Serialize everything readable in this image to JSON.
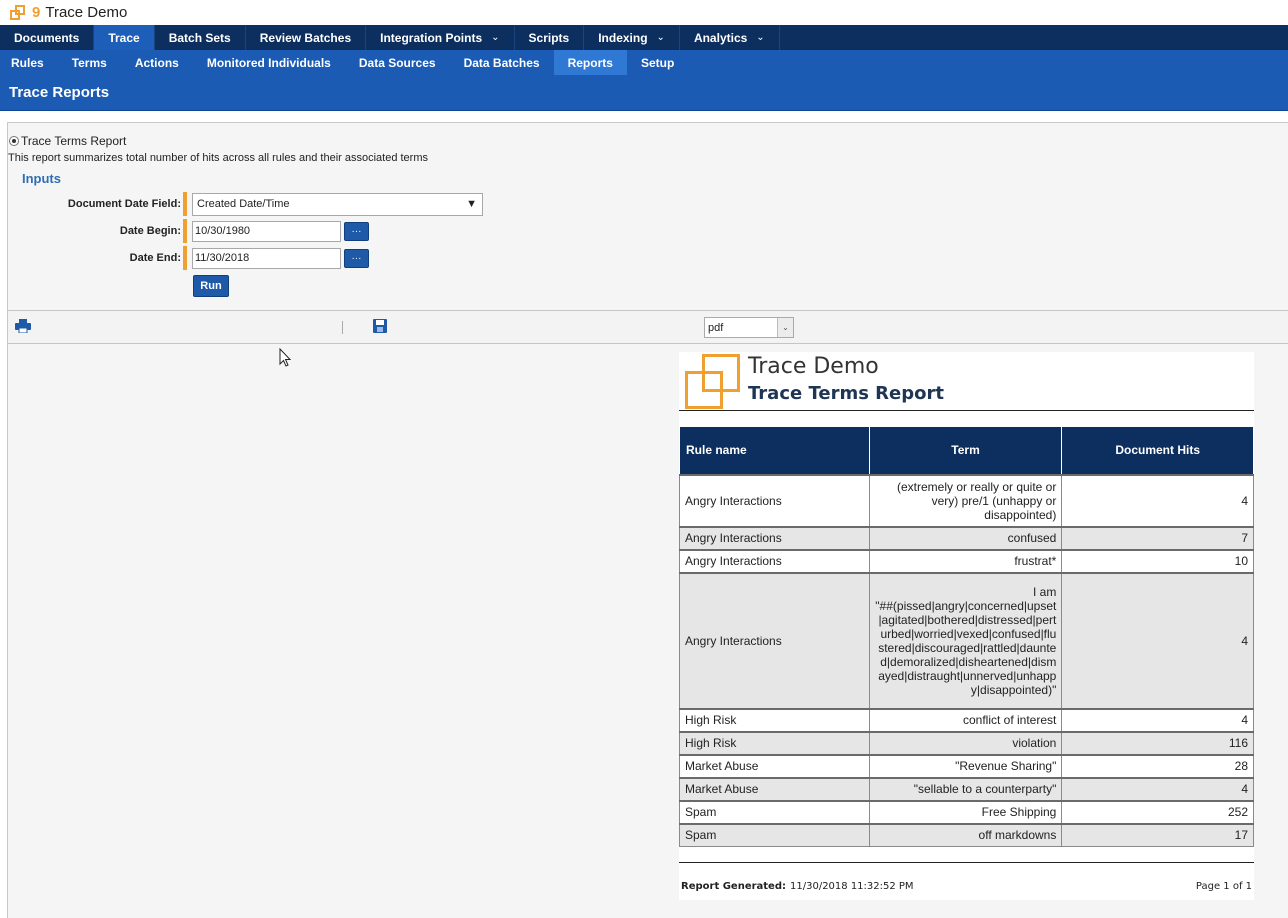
{
  "app": {
    "title": "Trace Demo",
    "logo_number": "9"
  },
  "nav_primary": [
    {
      "label": "Documents",
      "dropdown": false,
      "active": false
    },
    {
      "label": "Trace",
      "dropdown": false,
      "active": true
    },
    {
      "label": "Batch Sets",
      "dropdown": false,
      "active": false
    },
    {
      "label": "Review Batches",
      "dropdown": false,
      "active": false
    },
    {
      "label": "Integration Points",
      "dropdown": true,
      "active": false
    },
    {
      "label": "Scripts",
      "dropdown": false,
      "active": false
    },
    {
      "label": "Indexing",
      "dropdown": true,
      "active": false
    },
    {
      "label": "Analytics",
      "dropdown": true,
      "active": false
    }
  ],
  "nav_secondary": [
    {
      "label": "Rules",
      "active": false
    },
    {
      "label": "Terms",
      "active": false
    },
    {
      "label": "Actions",
      "active": false
    },
    {
      "label": "Monitored Individuals",
      "active": false
    },
    {
      "label": "Data Sources",
      "active": false
    },
    {
      "label": "Data Batches",
      "active": false
    },
    {
      "label": "Reports",
      "active": true
    },
    {
      "label": "Setup",
      "active": false
    }
  ],
  "page": {
    "title": "Trace Reports"
  },
  "report": {
    "name": "Trace Terms Report",
    "description": "This report summarizes total number of hits across all rules and their associated terms"
  },
  "inputs": {
    "heading": "Inputs",
    "date_field": {
      "label": "Document Date Field:",
      "value": "Created Date/Time"
    },
    "date_begin": {
      "label": "Date Begin:",
      "value": "10/30/1980",
      "button": "···"
    },
    "date_end": {
      "label": "Date End:",
      "value": "11/30/2018",
      "button": "···"
    },
    "run_label": "Run"
  },
  "toolbar": {
    "format": "pdf"
  },
  "document": {
    "title": "Trace Demo",
    "subtitle": "Trace Terms Report",
    "columns": [
      "Rule name",
      "Term",
      "Document Hits"
    ],
    "rows": [
      {
        "rule": "Angry Interactions",
        "term": "(extremely or really or quite or very) pre/1 (unhappy or disappointed)",
        "hits": "4"
      },
      {
        "rule": "Angry Interactions",
        "term": "confused",
        "hits": "7"
      },
      {
        "rule": "Angry Interactions",
        "term": "frustrat*",
        "hits": "10"
      },
      {
        "rule": "Angry Interactions",
        "term_first": "I am",
        "term": "\"##(pissed|angry|concerned|upset|agitated|bothered|distressed|perturbed|worried|vexed|confused|flustered|discouraged|rattled|daunted|demoralized|disheartened|dismayed|distraught|unnerved|unhappy|disappointed)\"",
        "hits": "4"
      },
      {
        "rule": "High Risk",
        "term": "conflict of interest",
        "hits": "4"
      },
      {
        "rule": "High Risk",
        "term": "violation",
        "hits": "116"
      },
      {
        "rule": "Market Abuse",
        "term": "\"Revenue Sharing\"",
        "hits": "28"
      },
      {
        "rule": "Market Abuse",
        "term": "\"sellable to a counterparty\"",
        "hits": "4"
      },
      {
        "rule": "Spam",
        "term": "Free Shipping",
        "hits": "252"
      },
      {
        "rule": "Spam",
        "term": "off markdowns",
        "hits": "17"
      }
    ],
    "footer": {
      "generated_label": "Report Generated:",
      "generated_value": "11/30/2018 11:32:52 PM",
      "page": "Page 1 of 1"
    }
  }
}
